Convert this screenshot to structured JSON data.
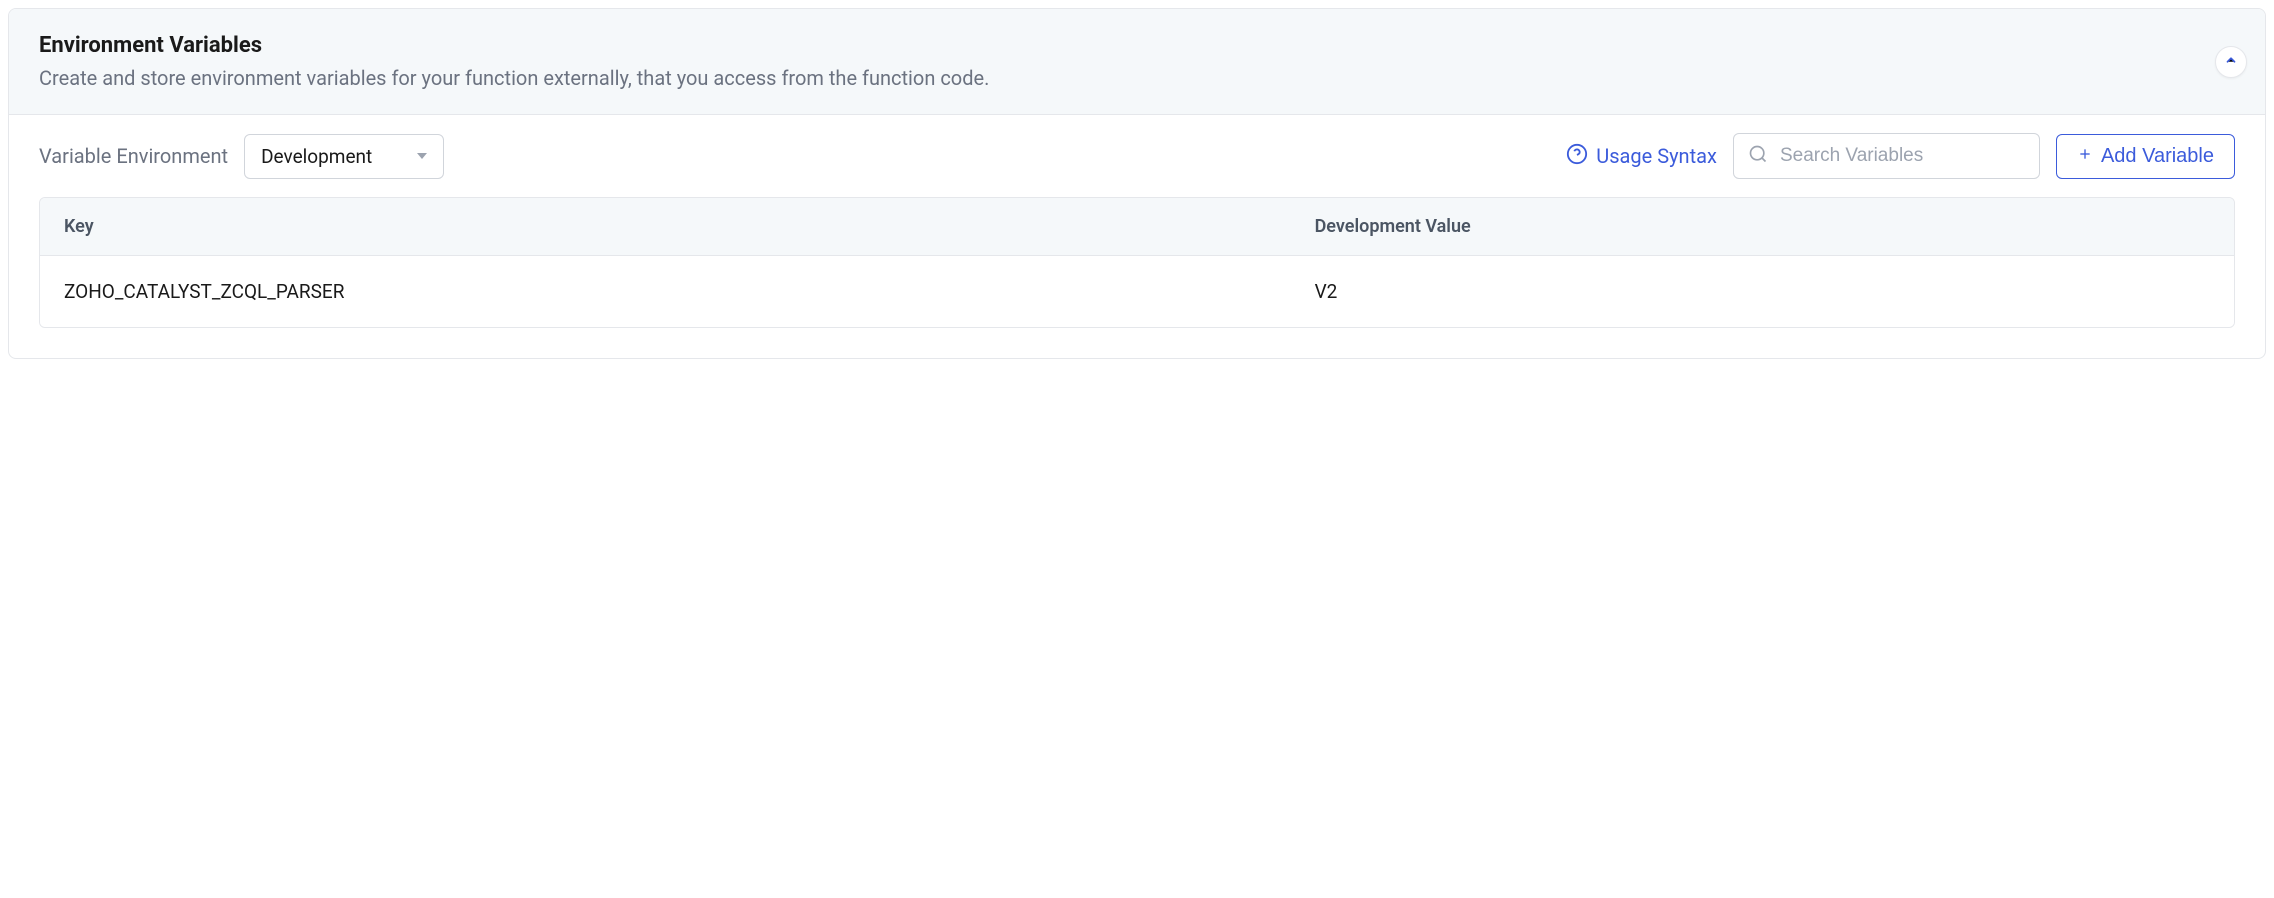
{
  "header": {
    "title": "Environment Variables",
    "subtitle": "Create and store environment variables for your function externally, that you access from the function code."
  },
  "toolbar": {
    "env_label": "Variable Environment",
    "env_dropdown_value": "Development",
    "usage_syntax_label": "Usage Syntax",
    "search_placeholder": "Search Variables",
    "add_button_label": "Add Variable"
  },
  "table": {
    "columns": {
      "key": "Key",
      "value": "Development Value"
    },
    "rows": [
      {
        "key": "ZOHO_CATALYST_ZCQL_PARSER",
        "value": "V2"
      }
    ]
  }
}
